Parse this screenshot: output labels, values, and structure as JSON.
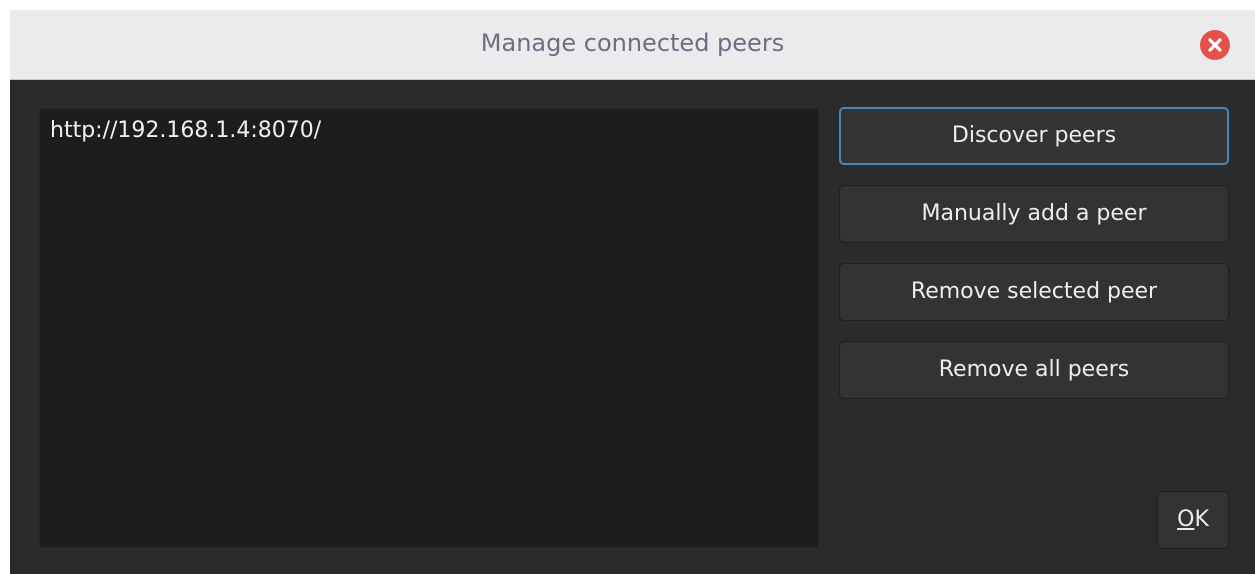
{
  "window": {
    "title": "Manage connected peers",
    "close_icon": "close-icon"
  },
  "peers": {
    "items": [
      "http://192.168.1.4:8070/"
    ]
  },
  "actions": {
    "discover_label": "Discover peers",
    "manual_add_label": "Manually add a peer",
    "remove_selected_label": "Remove selected peer",
    "remove_all_label": "Remove all peers",
    "ok_mnemonic": "O",
    "ok_rest": "K"
  },
  "colors": {
    "close_button": "#e4514a",
    "focus_border": "#4a85b8",
    "background": "#2b2b2b",
    "list_background": "#1d1d1d"
  }
}
